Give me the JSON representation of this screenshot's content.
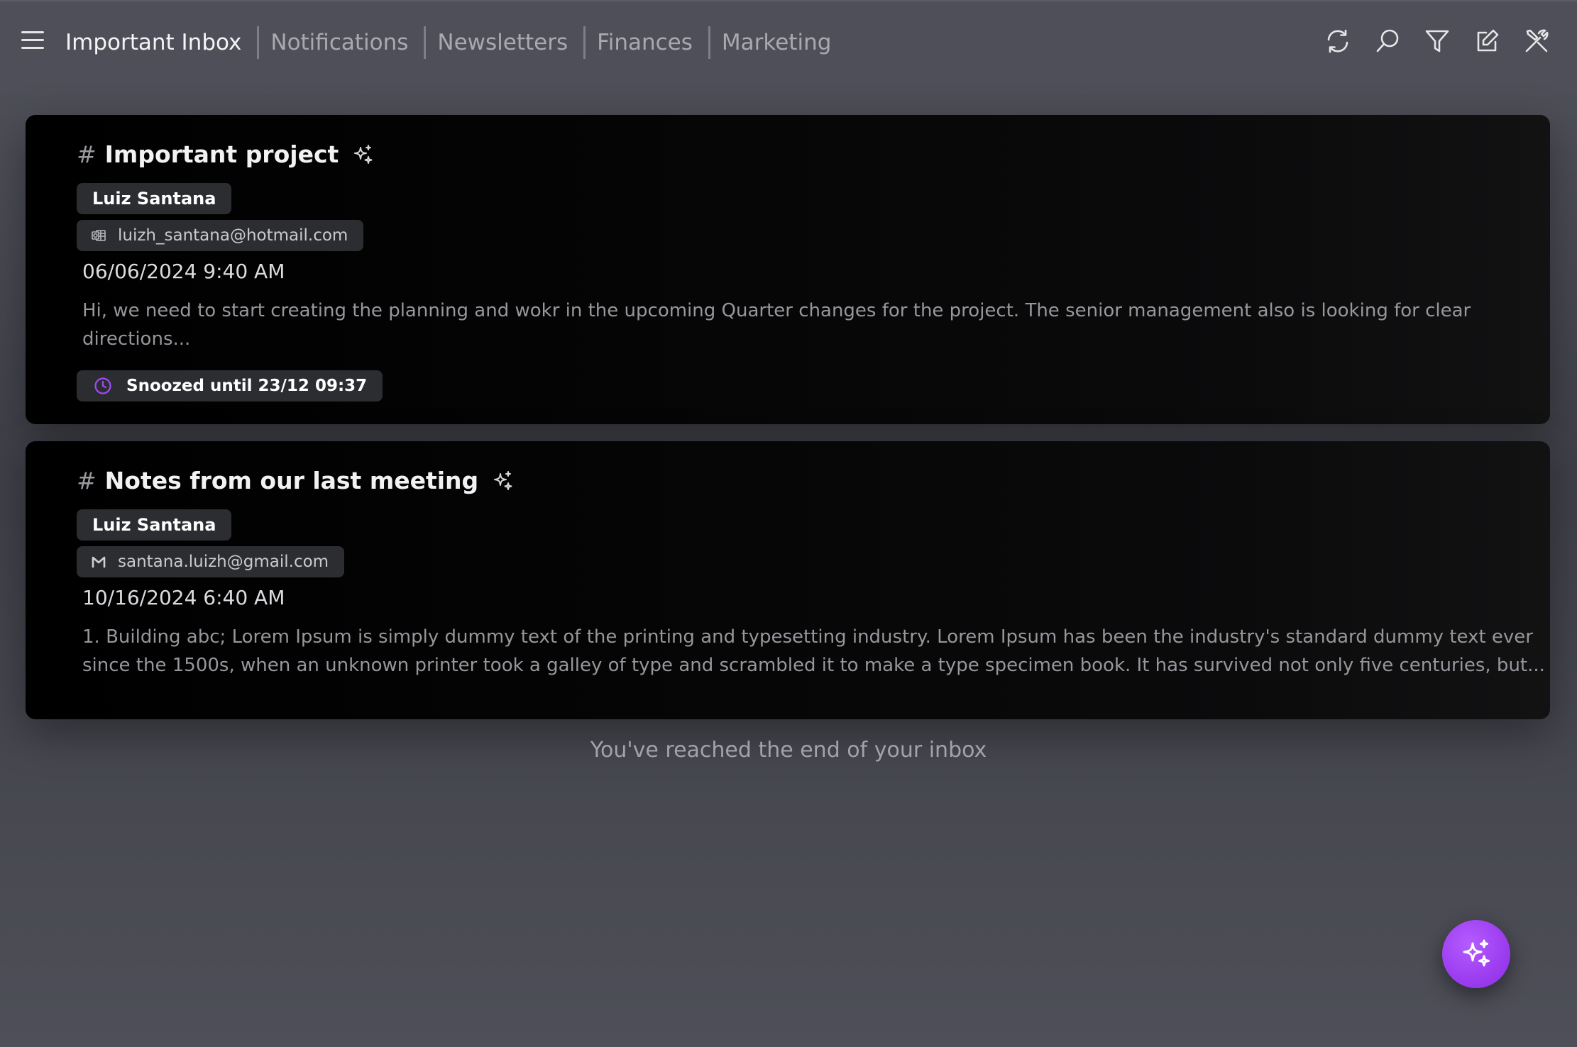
{
  "header": {
    "tabs": [
      {
        "label": "Important Inbox",
        "active": true
      },
      {
        "label": "Notifications",
        "active": false
      },
      {
        "label": "Newsletters",
        "active": false
      },
      {
        "label": "Finances",
        "active": false
      },
      {
        "label": "Marketing",
        "active": false
      }
    ],
    "toolbar": [
      "refresh-icon",
      "search-icon",
      "filter-icon",
      "compose-icon",
      "tools-icon"
    ]
  },
  "emails": [
    {
      "subject": "Important project",
      "sender": "Luiz Santana",
      "account_email": "luizh_santana@hotmail.com",
      "account_icon": "outlook-icon",
      "date": "06/06/2024 9:40 AM",
      "snippet": "Hi, we need to start creating the planning and wokr in the upcoming Quarter changes for the project. The senior management also is looking for clear directions...",
      "snooze_label": "Snoozed until 23/12 09:37"
    },
    {
      "subject": "Notes from our last meeting",
      "sender": "Luiz Santana",
      "account_email": "santana.luizh@gmail.com",
      "account_icon": "gmail-icon",
      "date": "10/16/2024 6:40 AM",
      "snippet": "1. Building abc; Lorem Ipsum is simply dummy text of the printing and typesetting industry. Lorem Ipsum has been the industry's standard dummy text ever since the 1500s, when an unknown printer took a galley of type and scrambled it to make a type specimen book. It has survived not only five centuries, but..."
    }
  ],
  "footer": {
    "end_message": "You've reached the end of your inbox"
  },
  "colors": {
    "accent": "#a24af5",
    "background": "#4e4f58",
    "card": "#000000"
  }
}
